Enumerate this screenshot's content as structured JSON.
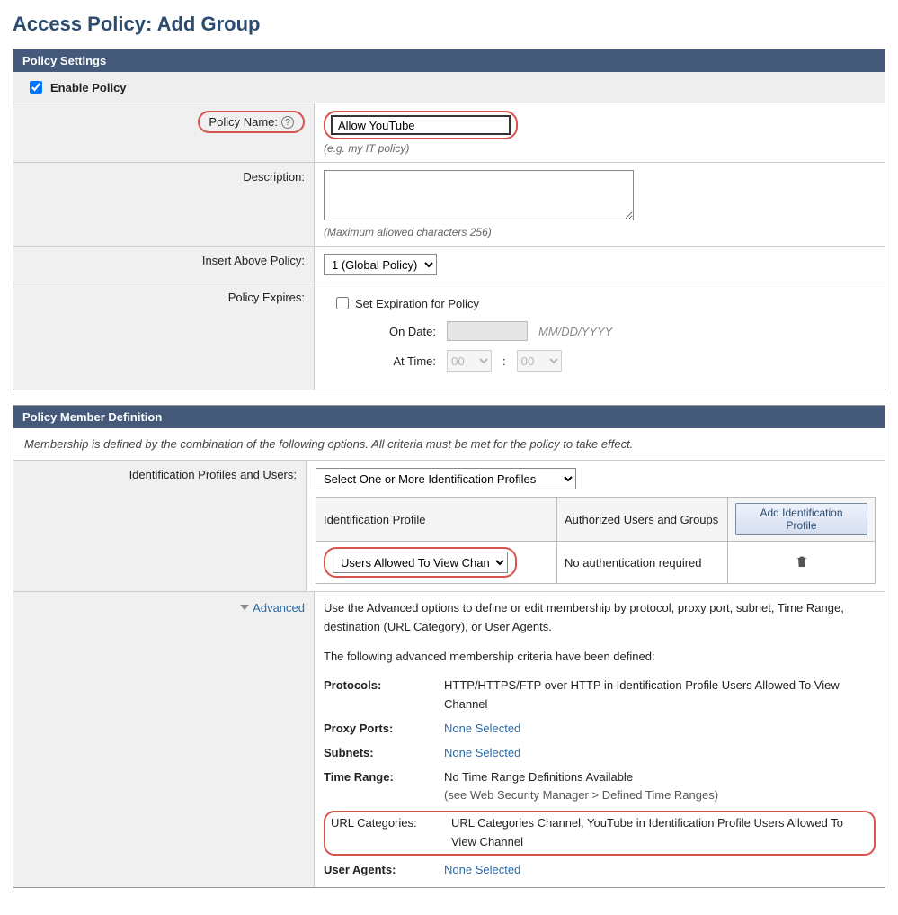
{
  "page_title": "Access Policy: Add Group",
  "policy_settings": {
    "header": "Policy Settings",
    "enable_label": "Enable Policy",
    "enable_checked": true,
    "policy_name": {
      "label": "Policy Name:",
      "value": "Allow YouTube",
      "hint": "(e.g. my IT policy)"
    },
    "description": {
      "label": "Description:",
      "hint": "(Maximum allowed characters 256)"
    },
    "insert_above": {
      "label": "Insert Above Policy:",
      "selected": "1 (Global Policy)"
    },
    "expires": {
      "label": "Policy Expires:",
      "checkbox_label": "Set Expiration for Policy",
      "on_date_label": "On Date:",
      "date_hint": "MM/DD/YYYY",
      "at_time_label": "At Time:",
      "hour": "00",
      "minute": "00"
    }
  },
  "member": {
    "header": "Policy Member Definition",
    "intro": "Membership is defined by the combination of the following options. All criteria must be met for the policy to take effect.",
    "id_profiles": {
      "label": "Identification Profiles and Users:",
      "selector": "Select One or More Identification Profiles",
      "col_profile": "Identification Profile",
      "col_auth": "Authorized Users and Groups",
      "add_btn": "Add Identification Profile",
      "row_profile_selected": "Users Allowed To View Channel",
      "row_auth_text": "No authentication required"
    },
    "advanced": {
      "toggle": "Advanced",
      "intro1": "Use the Advanced options to define or edit membership by protocol, proxy port, subnet, Time Range, destination (URL Category), or User Agents.",
      "intro2": "The following advanced membership criteria have been defined:",
      "protocols_label": "Protocols:",
      "protocols_value": "HTTP/HTTPS/FTP over HTTP in Identification Profile Users Allowed To View Channel",
      "proxy_label": "Proxy Ports:",
      "none": "None Selected",
      "subnets_label": "Subnets:",
      "time_label": "Time Range:",
      "time_value_line1": "No Time Range Definitions Available",
      "time_value_line2": "(see Web Security Manager > Defined Time Ranges)",
      "urlcat_label": "URL Categories:",
      "urlcat_value": "URL Categories Channel, YouTube in Identification Profile Users Allowed To View Channel",
      "ua_label": "User Agents:"
    }
  }
}
